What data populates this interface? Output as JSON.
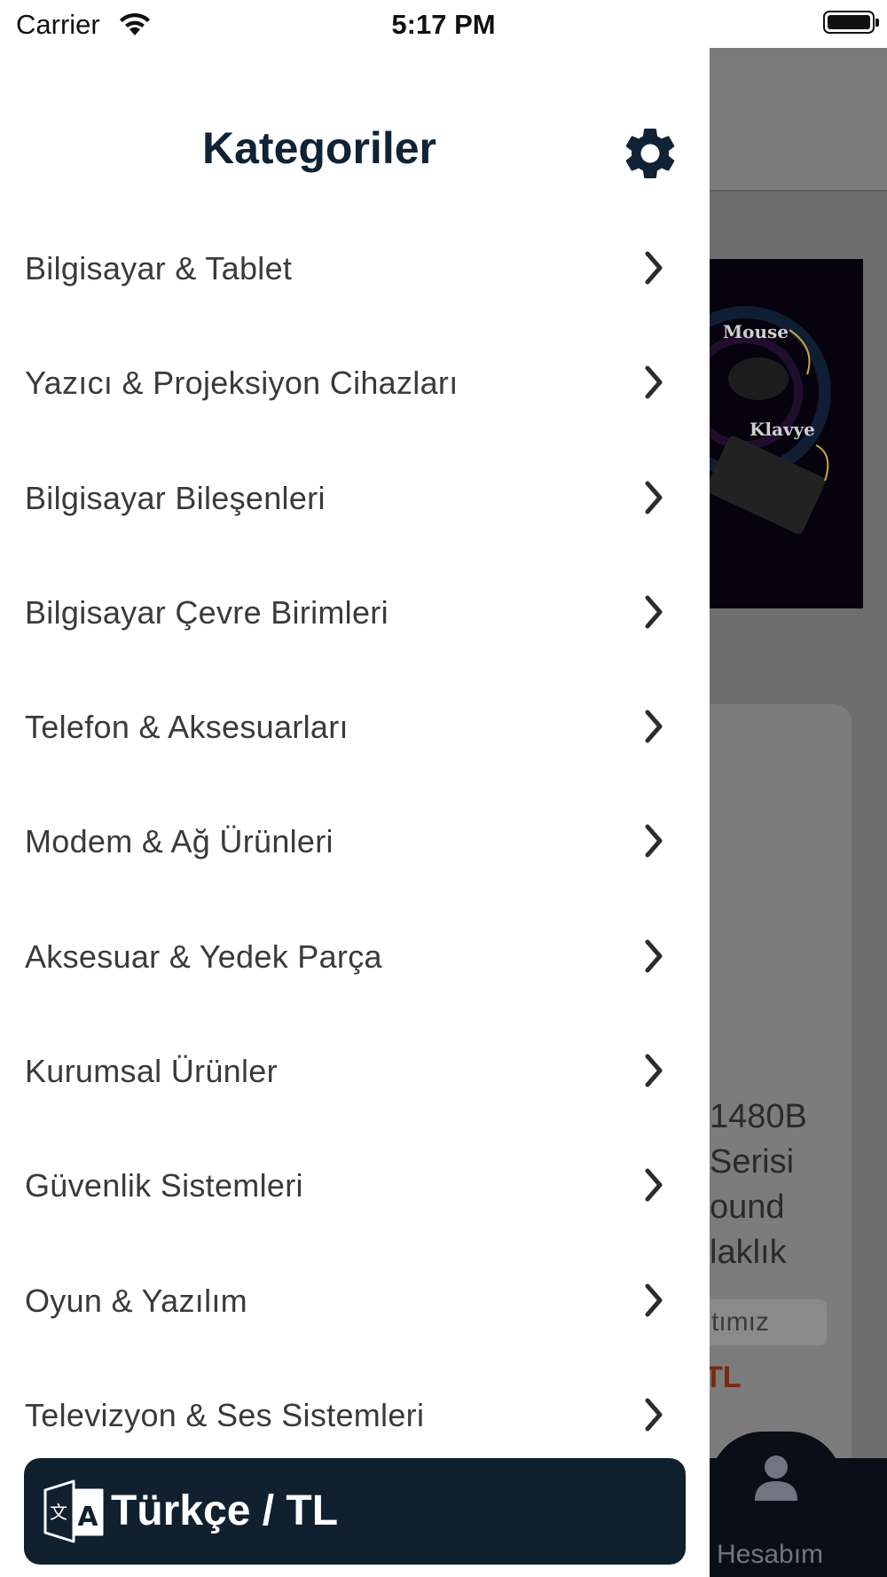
{
  "status_bar": {
    "carrier": "Carrier",
    "time": "5:17 PM"
  },
  "drawer": {
    "title": "Kategoriler",
    "categories": [
      {
        "label": "Bilgisayar & Tablet"
      },
      {
        "label": "Yazıcı & Projeksiyon Cihazları"
      },
      {
        "label": "Bilgisayar Bileşenleri"
      },
      {
        "label": "Bilgisayar Çevre Birimleri"
      },
      {
        "label": "Telefon & Aksesuarları"
      },
      {
        "label": "Modem & Ağ Ürünleri"
      },
      {
        "label": "Aksesuar & Yedek Parça"
      },
      {
        "label": "Kurumsal Ürünler"
      },
      {
        "label": "Güvenlik Sistemleri"
      },
      {
        "label": "Oyun & Yazılım"
      },
      {
        "label": "Televizyon & Ses Sistemleri"
      }
    ],
    "language_button": {
      "label": "Türkçe / TL",
      "icon": "translate-icon"
    },
    "settings_icon": "gear-icon"
  },
  "background": {
    "banner": {
      "text_mouse": "Mouse",
      "text_keyboard": "Klavye"
    },
    "product_lines": [
      "1480B",
      "Serisi",
      "ound",
      "laklık"
    ],
    "pill_text": "tımız",
    "price_text": "TL",
    "tab_label": "Hesabım"
  },
  "colors": {
    "drawer_title": "#0f2236",
    "language_button_bg": "#10202f",
    "overlay": "#6e6e6e"
  }
}
